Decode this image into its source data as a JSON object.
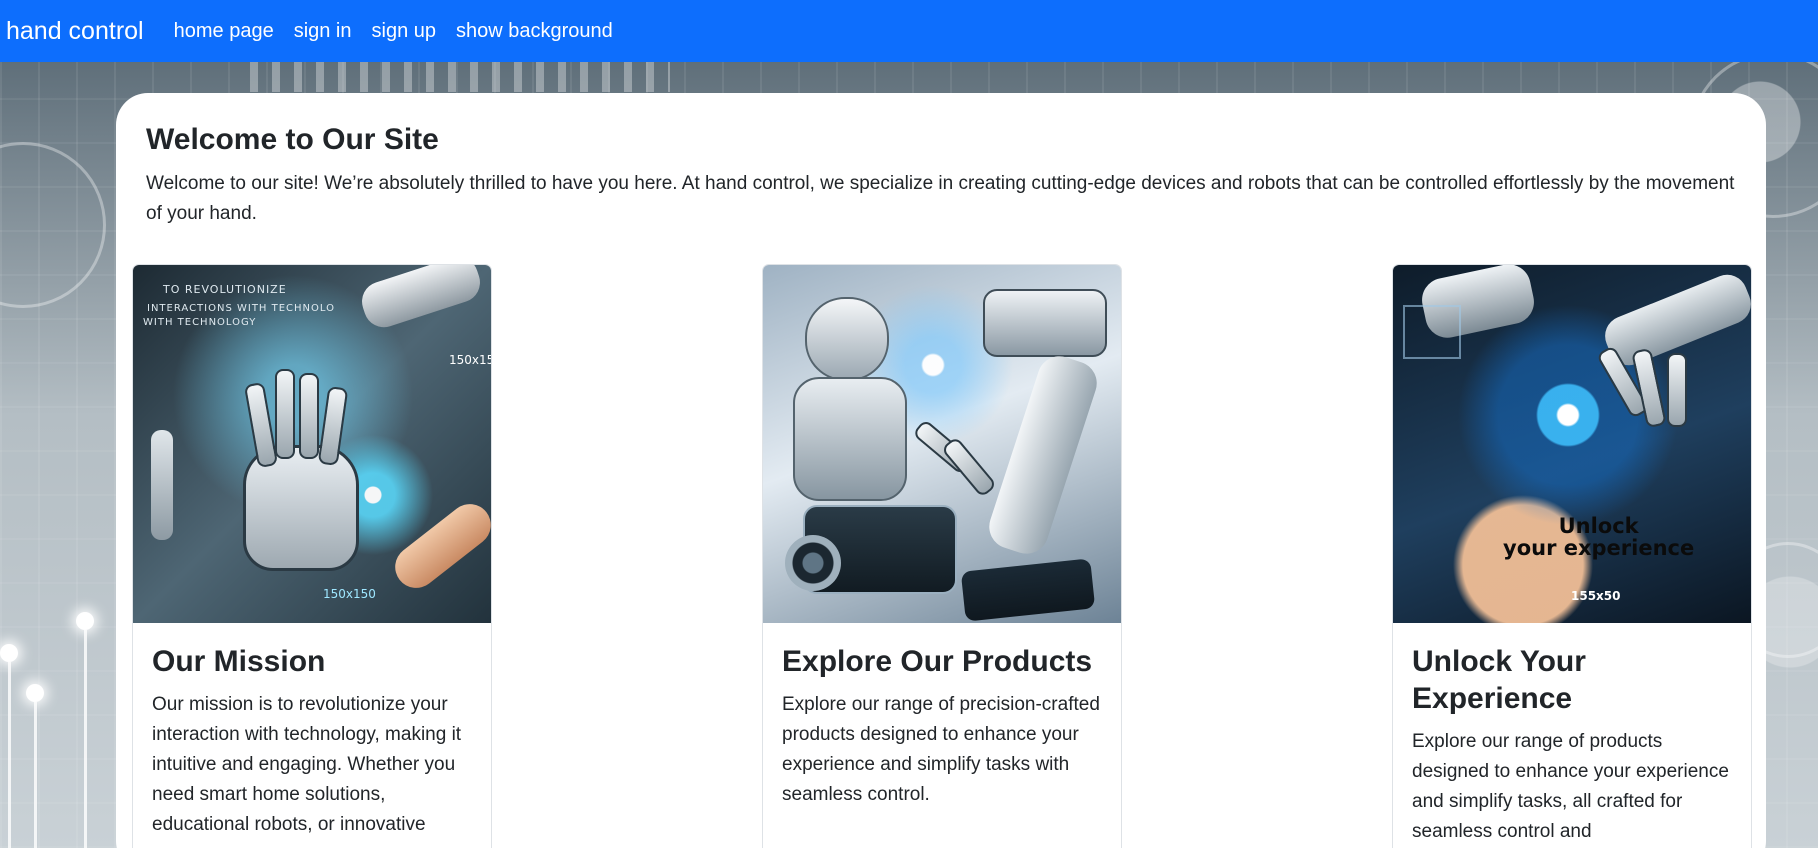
{
  "navbar": {
    "brand": "hand control",
    "links": [
      "home page",
      "sign in",
      "sign up",
      "show background"
    ],
    "background_color": "#0d6efd"
  },
  "welcome": {
    "title": "Welcome to Our Site",
    "text": "Welcome to our site! We’re absolutely thrilled to have you here. At hand control, we specialize in creating cutting-edge devices and robots that can be controlled effortlessly by the movement of your hand."
  },
  "cards": [
    {
      "title": "Our Mission",
      "text": "Our mission is to revolutionize your interaction with technology, making it intuitive and engaging. Whether you need smart home solutions, educational robots, or innovative",
      "image_text_1": "TO   REVOLUTIONIZE",
      "image_text_2": "INTERACTIONS WITH TECHNOLO",
      "image_text_3": "WITH TECHNOLOGY",
      "image_label_1": "150x150",
      "image_label_2": "150x150"
    },
    {
      "title": "Explore Our Products",
      "text": "Explore our range of precision-crafted products designed to enhance your experience and simplify tasks with seamless control."
    },
    {
      "title": "Unlock Your Experience",
      "text": "Explore our range of products designed to enhance your experience and simplify tasks, all crafted for seamless control and",
      "image_text_1": "Unlock",
      "image_text_2": "your experience",
      "image_label": "155x50"
    }
  ]
}
